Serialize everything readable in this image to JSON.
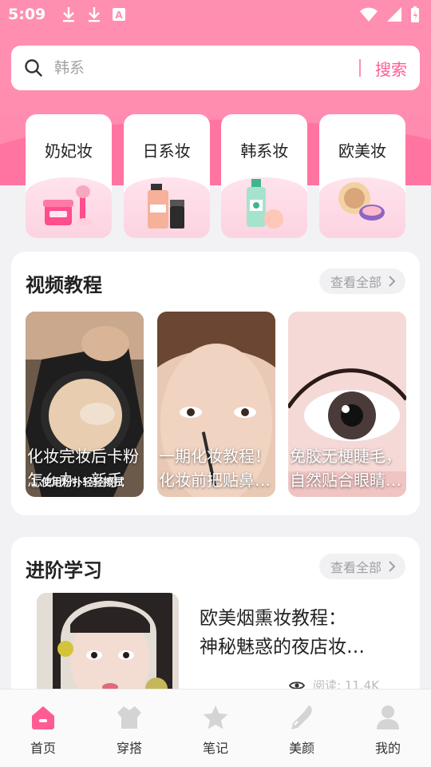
{
  "status_bar": {
    "time": "5:09",
    "left_icons": [
      "download-icon",
      "download-icon",
      "font-icon"
    ],
    "right_icons": [
      "wifi-icon",
      "signal-icon",
      "battery-charging-icon"
    ]
  },
  "search": {
    "placeholder": "韩系",
    "button_label": "搜索"
  },
  "categories": [
    {
      "label": "奶妃妆",
      "icon": "cream-jar-brush-icon"
    },
    {
      "label": "日系妆",
      "icon": "foundation-bottle-icon"
    },
    {
      "label": "韩系妆",
      "icon": "toner-bottle-puff-icon"
    },
    {
      "label": "欧美妆",
      "icon": "powder-compact-icon"
    }
  ],
  "video_section": {
    "title": "视频教程",
    "more_label": "查看全部",
    "videos": [
      {
        "caption_line1": "化妆完妆后卡粉",
        "caption_line2": "怎么办，新手",
        "subtitle": "1 使用粉扑轻轻擦拭"
      },
      {
        "caption_line1": "一期化妆教程！",
        "caption_line2": "化妆前把贴鼻…"
      },
      {
        "caption_line1": "免胶无梗睫毛，",
        "caption_line2": "自然贴合眼睛…"
      }
    ]
  },
  "learning_section": {
    "title": "进阶学习",
    "more_label": "查看全部",
    "article": {
      "title_line1": "欧美烟熏妆教程：",
      "title_line2": "神秘魅惑的夜店妆…",
      "reads": "阅读: 11.4K"
    }
  },
  "tabbar": [
    {
      "label": "首页",
      "icon": "home-icon",
      "active": true
    },
    {
      "label": "穿搭",
      "icon": "shirt-icon",
      "active": false
    },
    {
      "label": "笔记",
      "icon": "star-icon",
      "active": false
    },
    {
      "label": "美颜",
      "icon": "pen-icon",
      "active": false
    },
    {
      "label": "我的",
      "icon": "user-icon",
      "active": false
    }
  ],
  "colors": {
    "accent": "#ff5c93",
    "hero_pink": "#ff8fb1",
    "tab_inactive": "#d4d4d4"
  }
}
